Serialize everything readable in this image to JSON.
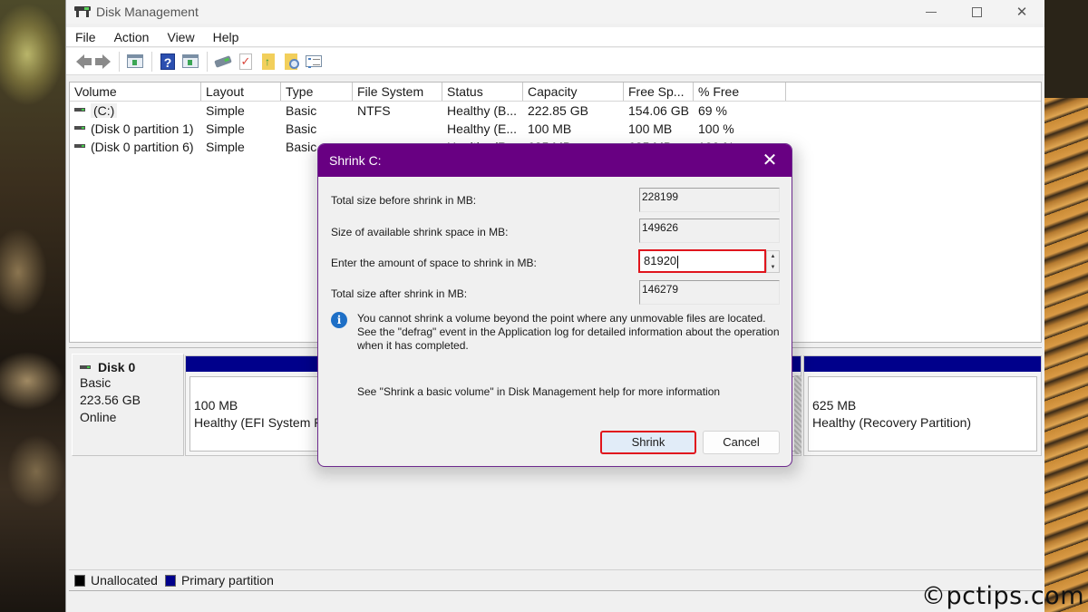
{
  "window": {
    "title": "Disk Management",
    "controls": {
      "minimize": "minimize",
      "maximize": "maximize",
      "close": "✕"
    }
  },
  "menu": [
    "File",
    "Action",
    "View",
    "Help"
  ],
  "toolbar": {
    "icons": [
      "back-icon",
      "forward-icon",
      "show-hide-console-tree-icon",
      "help-icon",
      "show-hide-action-pane-icon",
      "connect-disk-icon",
      "check-icon",
      "folder-up-icon",
      "folder-search-icon",
      "properties-list-icon"
    ]
  },
  "volume_list": {
    "columns": [
      "Volume",
      "Layout",
      "Type",
      "File System",
      "Status",
      "Capacity",
      "Free Sp...",
      "% Free"
    ],
    "rows": [
      {
        "volume": "(C:)",
        "layout": "Simple",
        "type": "Basic",
        "fs": "NTFS",
        "status": "Healthy (B...",
        "capacity": "222.85 GB",
        "free": "154.06 GB",
        "pct": "69 %"
      },
      {
        "volume": "(Disk 0 partition 1)",
        "layout": "Simple",
        "type": "Basic",
        "fs": "",
        "status": "Healthy (E...",
        "capacity": "100 MB",
        "free": "100 MB",
        "pct": "100 %"
      },
      {
        "volume": "(Disk 0 partition 6)",
        "layout": "Simple",
        "type": "Basic",
        "fs": "",
        "status": "Healthy (R...",
        "capacity": "625 MB",
        "free": "625 MB",
        "pct": "100 %"
      }
    ]
  },
  "disk": {
    "name": "Disk 0",
    "type": "Basic",
    "size": "223.56 GB",
    "state": "Online",
    "partitions": [
      {
        "size": "100 MB",
        "status": "Healthy (EFI System Partition)"
      },
      {
        "size": "625 MB",
        "status": "Healthy (Recovery Partition)"
      }
    ]
  },
  "legend": [
    {
      "label": "Unallocated",
      "color": "#000000"
    },
    {
      "label": "Primary partition",
      "color": "#00008b"
    }
  ],
  "dialog": {
    "title": "Shrink C:",
    "close": "✕",
    "accent": "#680082",
    "fields": [
      {
        "label": "Total size before shrink in MB:",
        "value": "228199"
      },
      {
        "label": "Size of available shrink space in MB:",
        "value": "149626"
      },
      {
        "label": "Enter the amount of space to shrink in MB:",
        "value": "81920"
      },
      {
        "label": "Total size after shrink in MB:",
        "value": "146279"
      }
    ],
    "info": "You cannot shrink a volume beyond the point where any unmovable files are located. See the \"defrag\" event in the Application log for detailed information about the operation when it has completed.",
    "help": "See \"Shrink a basic volume\" in Disk Management help for more information",
    "buttons": {
      "shrink": "Shrink",
      "cancel": "Cancel"
    },
    "highlight_color": "#e0151d"
  },
  "watermark": "©pctips.com"
}
